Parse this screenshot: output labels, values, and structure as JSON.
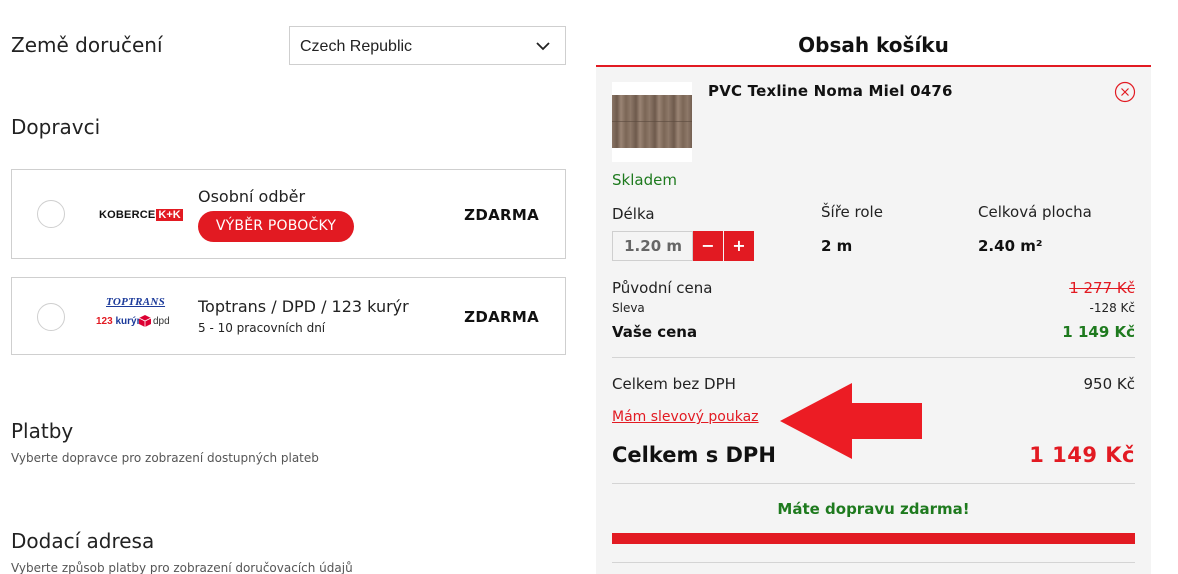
{
  "delivery": {
    "country_label": "Země doručení",
    "country_value": "Czech Republic"
  },
  "carriers": {
    "title": "Dopravci",
    "items": [
      {
        "logo_text": "KOBERCE",
        "logo_badge": "K+K",
        "name": "Osobní odběr",
        "button_label": "VÝBĚR POBOČKY",
        "price": "ZDARMA"
      },
      {
        "logo_top": "TOPTRANS",
        "logo_123": "123",
        "logo_kuryr": "kurýr",
        "logo_dpd": "dpd",
        "name": "Toptrans / DPD / 123 kurýr",
        "subtitle": "5 - 10 pracovních dní",
        "price": "ZDARMA"
      }
    ]
  },
  "payments": {
    "title": "Platby",
    "subtitle": "Vyberte dopravce pro zobrazení dostupných plateb"
  },
  "address": {
    "title": "Dodací adresa",
    "subtitle": "Vyberte způsob platby pro zobrazení doručovacích údajů"
  },
  "cart": {
    "title": "Obsah košíku",
    "product": {
      "name": "PVC Texline Noma Miel 0476",
      "stock": "Skladem",
      "length_label": "Délka",
      "length_value": "1.20 m",
      "width_label": "Šíře role",
      "width_value": "2 m",
      "area_label": "Celková plocha",
      "area_value": "2.40 m²",
      "minus_label": "−",
      "plus_label": "+"
    },
    "original_price_label": "Původní cena",
    "original_price": "1 277 Kč",
    "discount_label": "Sleva",
    "discount": "-128 Kč",
    "your_price_label": "Vaše cena",
    "your_price": "1 149 Kč",
    "net_label": "Celkem bez DPH",
    "net_value": "950 Kč",
    "voucher_link": "Mám slevový poukaz",
    "total_label": "Celkem s DPH",
    "total_value": "1 149 Kč",
    "free_shipping": "Máte dopravu zdarma!",
    "free_shipping_progress": 1.0
  },
  "colors": {
    "accent": "#e21a22",
    "success": "#1e7a1e",
    "panel_bg": "#f4f4f4"
  },
  "icons": {
    "select": "chevron-down-icon",
    "remove": "close-circle-icon",
    "annotation": "left-arrow-icon"
  }
}
